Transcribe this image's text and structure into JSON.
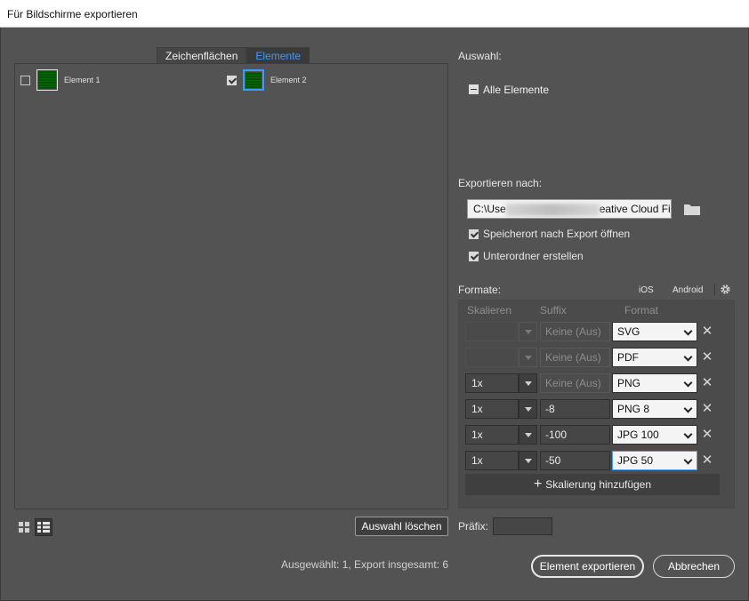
{
  "window": {
    "title": "Für Bildschirme exportieren"
  },
  "tabs": [
    {
      "label": "Zeichenflächen",
      "active": false
    },
    {
      "label": "Elemente",
      "active": true
    }
  ],
  "assets": [
    {
      "label": "Element 1",
      "checked": false
    },
    {
      "label": "Element 2",
      "checked": true
    }
  ],
  "left_footer": {
    "clear_button": "Auswahl löschen",
    "status": "Ausgewählt: 1, Export insgesamt: 6"
  },
  "selection": {
    "title": "Auswahl:",
    "all_elements": "Alle Elemente"
  },
  "export_to": {
    "title": "Exportieren nach:",
    "path_start": "C:\\Use",
    "path_end": "eative Cloud File",
    "open_after": "Speicherort nach Export öffnen",
    "create_subfolder": "Unterordner erstellen"
  },
  "formats": {
    "title": "Formate:",
    "ios": "iOS",
    "android": "Android",
    "col_scale": "Skalieren",
    "col_suffix": "Suffix",
    "col_format": "Format",
    "rows": [
      {
        "scale": "",
        "suffix": "Keine (Aus)",
        "format": "SVG"
      },
      {
        "scale": "",
        "suffix": "Keine (Aus)",
        "format": "PDF"
      },
      {
        "scale": "1x",
        "suffix": "Keine (Aus)",
        "format": "PNG"
      },
      {
        "scale": "1x",
        "suffix": "-8",
        "format": "PNG 8"
      },
      {
        "scale": "1x",
        "suffix": "-100",
        "format": "JPG 100"
      },
      {
        "scale": "1x",
        "suffix": "-50",
        "format": "JPG 50"
      }
    ],
    "add_scale": "Skalierung hinzufügen"
  },
  "prefix": {
    "label": "Präfix:",
    "value": ""
  },
  "actions": {
    "export": "Element exportieren",
    "cancel": "Abbrechen"
  }
}
